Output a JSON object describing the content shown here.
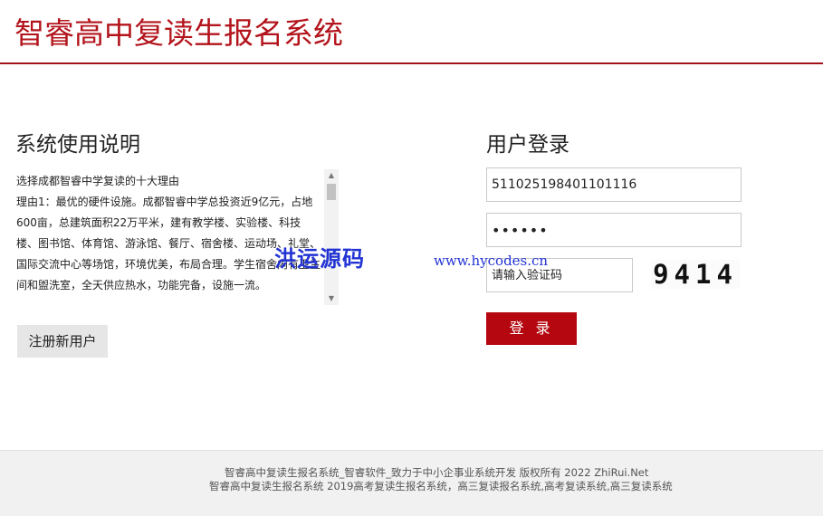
{
  "header": {
    "title": "智睿高中复读生报名系统"
  },
  "instructions": {
    "title": "系统使用说明",
    "lines": [
      "选择成都智睿中学复读的十大理由",
      "理由1：最优的硬件设施。成都智睿中学总投资近9亿元，占地600亩，总建筑面积22万平米，建有教学楼、实验楼、科技楼、图书馆、体育馆、游泳馆、餐厅、宿舍楼、运动场、礼堂、国际交流中心等场馆，环境优美，布局合理。学生宿舍内有卫生间和盥洗室，全天供应热水，功能完备，设施一流。"
    ],
    "scroll_up_icon": "▲",
    "scroll_down_icon": "▼",
    "register_label": "注册新用户"
  },
  "login": {
    "title": "用户登录",
    "username_value": "511025198401101116",
    "password_value": "••••••",
    "captcha_placeholder": "请输入验证码",
    "captcha_code": "9414",
    "submit_label": "登 录"
  },
  "watermark": {
    "cn_text": "洪运源码",
    "url_text": "www.hycodes.cn"
  },
  "footer": {
    "line1": "智睿高中复读生报名系统_智睿软件_致力于中小企事业系统开发  版权所有  2022 ZhiRui.Net",
    "line2": "智睿高中复读生报名系统 2019高考复读生报名系统，高三复读报名系统,高考复读系统,高三复读系统"
  },
  "colors": {
    "brand": "#b3141c",
    "login_button": "#b4070f",
    "watermark": "#2233d4"
  }
}
